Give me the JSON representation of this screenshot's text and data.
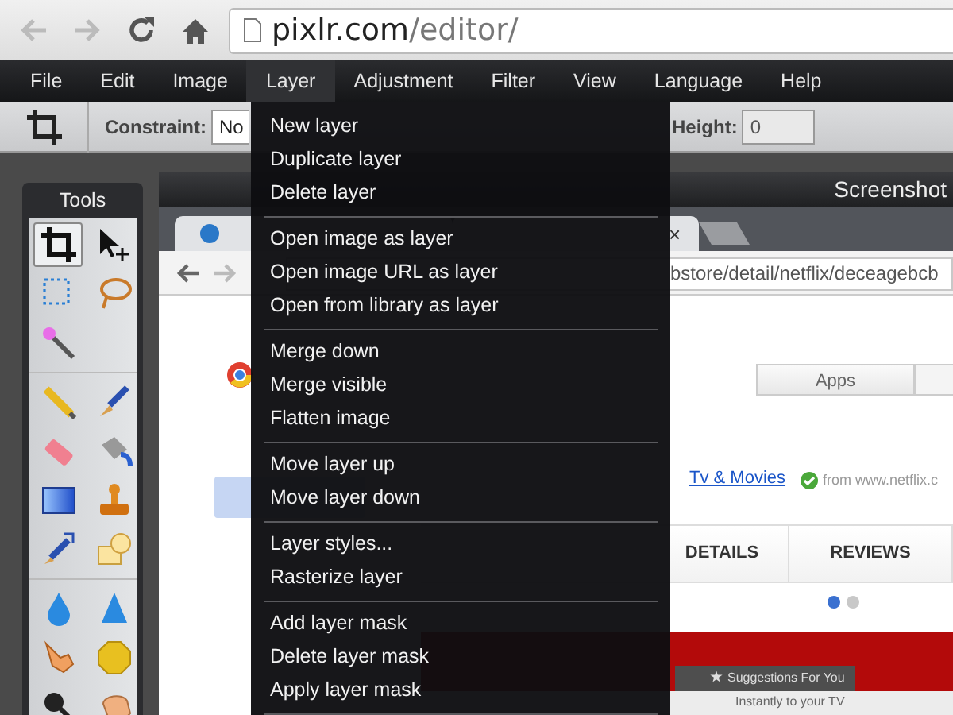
{
  "browser": {
    "url_host": "pixlr.com",
    "url_path": "/editor/"
  },
  "menu_bar": [
    {
      "label": "File",
      "selected": false
    },
    {
      "label": "Edit",
      "selected": false
    },
    {
      "label": "Image",
      "selected": false
    },
    {
      "label": "Layer",
      "selected": true
    },
    {
      "label": "Adjustment",
      "selected": false
    },
    {
      "label": "Filter",
      "selected": false
    },
    {
      "label": "View",
      "selected": false
    },
    {
      "label": "Language",
      "selected": false
    },
    {
      "label": "Help",
      "selected": false
    }
  ],
  "options_bar": {
    "constraint_label": "Constraint:",
    "constraint_value": "No",
    "height_label": "Height:",
    "height_value": "0"
  },
  "tools": {
    "title": "Tools",
    "groups": [
      [
        {
          "kind": "crop",
          "selected": true
        },
        {
          "kind": "move",
          "selected": false
        },
        {
          "kind": "marquee",
          "selected": false
        },
        {
          "kind": "lasso",
          "selected": false
        },
        {
          "kind": "wand",
          "selected": false
        }
      ],
      [
        {
          "kind": "pencil",
          "selected": false
        },
        {
          "kind": "brush",
          "selected": false
        },
        {
          "kind": "eraser",
          "selected": false
        },
        {
          "kind": "bucket",
          "selected": false
        },
        {
          "kind": "gradient",
          "selected": false
        },
        {
          "kind": "stamp",
          "selected": false
        },
        {
          "kind": "replace",
          "selected": false
        },
        {
          "kind": "shape",
          "selected": false
        }
      ],
      [
        {
          "kind": "drop",
          "selected": false
        },
        {
          "kind": "sharpen",
          "selected": false
        },
        {
          "kind": "finger",
          "selected": false
        },
        {
          "kind": "sponge",
          "selected": false
        },
        {
          "kind": "magnifier",
          "selected": false
        },
        {
          "kind": "hand",
          "selected": false
        }
      ]
    ]
  },
  "image_window": {
    "title": "Screenshot",
    "screenshot": {
      "tab_close": "×",
      "url": "bstore/detail/netflix/deceagebcb",
      "apps_button": "Apps",
      "category_link": "Tv & Movies",
      "publisher": "from www.netflix.c",
      "tabs": [
        "DETAILS",
        "REVIEWS"
      ],
      "banner_nav": [
        "Suggestions For You"
      ],
      "banner_caption": "Instantly to your TV"
    }
  },
  "layer_menu": {
    "groups": [
      [
        {
          "label": "New layer"
        },
        {
          "label": "Duplicate layer"
        },
        {
          "label": "Delete layer"
        }
      ],
      [
        {
          "label": "Open image as layer"
        },
        {
          "label": "Open image URL as layer"
        },
        {
          "label": "Open from library as layer"
        }
      ],
      [
        {
          "label": "Merge down"
        },
        {
          "label": "Merge visible"
        },
        {
          "label": "Flatten image"
        }
      ],
      [
        {
          "label": "Move layer up"
        },
        {
          "label": "Move layer down"
        }
      ],
      [
        {
          "label": "Layer styles..."
        },
        {
          "label": "Rasterize layer"
        }
      ],
      [
        {
          "label": "Add layer mask"
        },
        {
          "label": "Delete layer mask"
        },
        {
          "label": "Apply layer mask"
        }
      ]
    ]
  }
}
